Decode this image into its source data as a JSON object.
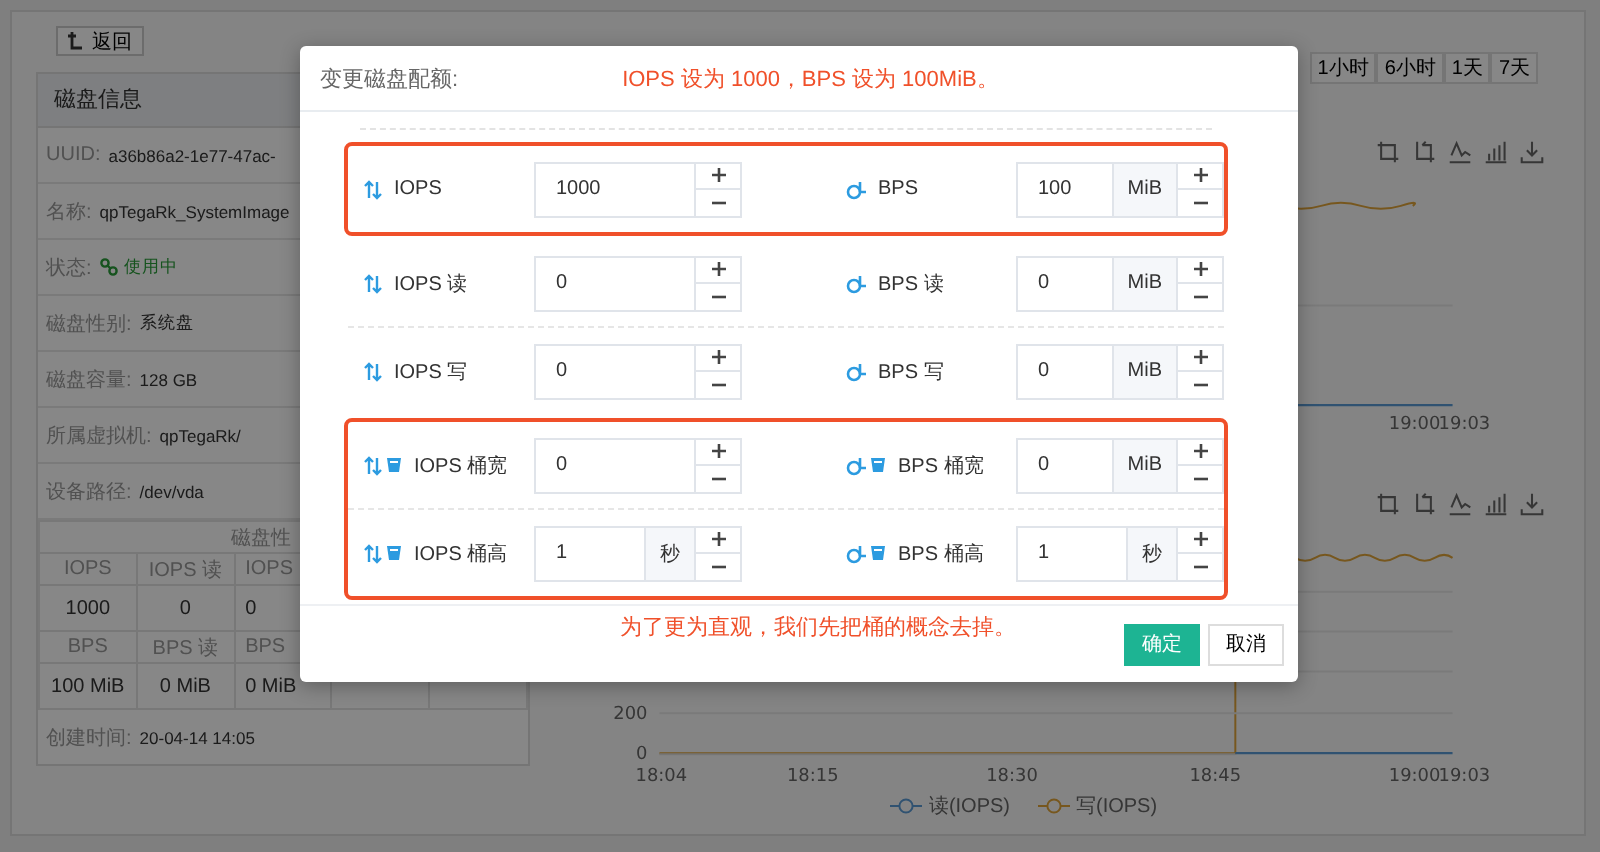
{
  "back_button": {
    "label": "返回"
  },
  "disk_info": {
    "title": "磁盘信息",
    "fields": [
      {
        "label": "UUID:",
        "value": "a36b86a2-1e77-47ac-",
        "kind": "text"
      },
      {
        "label": "名称:",
        "value": "qpTegaRk_SystemImage",
        "kind": "text"
      },
      {
        "label": "状态:",
        "value": "使用中",
        "kind": "status"
      },
      {
        "label": "磁盘性别:",
        "value": "系统盘",
        "kind": "text"
      },
      {
        "label": "磁盘容量:",
        "value": "128 GB",
        "kind": "text"
      },
      {
        "label": "所属虚拟机:",
        "value": "qpTegaRk/",
        "kind": "text"
      },
      {
        "label": "设备路径:",
        "value": "/dev/vda",
        "kind": "text"
      }
    ],
    "performance": {
      "title": "磁盘性",
      "rows": [
        {
          "kind": "header",
          "cells": [
            "IOPS",
            "IOPS 读",
            "IOPS"
          ]
        },
        {
          "kind": "value",
          "cells": [
            "1000",
            "0",
            "0"
          ]
        },
        {
          "kind": "header",
          "cells": [
            "BPS",
            "BPS 读",
            "BPS"
          ]
        },
        {
          "kind": "value",
          "cells": [
            "100 MiB",
            "0 MiB",
            "0 MiB"
          ]
        }
      ]
    },
    "created": {
      "label": "创建时间:",
      "value": "20-04-14 14:05"
    }
  },
  "time_ranges": [
    {
      "label": "1小时",
      "selected": false
    },
    {
      "label": "6小时",
      "selected": false
    },
    {
      "label": "1天",
      "selected": false
    },
    {
      "label": "7天",
      "selected": false
    }
  ],
  "charts": [
    {
      "x_labels": [
        "19:00",
        "19:03"
      ]
    },
    {
      "y_labels": [
        "200",
        "0"
      ],
      "x_labels": [
        "18:04",
        "18:15",
        "18:30",
        "18:45",
        "19:00",
        "19:03"
      ],
      "legend": [
        {
          "label": "读(IOPS)"
        },
        {
          "label": "写(IOPS)"
        }
      ]
    }
  ],
  "modal": {
    "title": "变更磁盘配额:",
    "top_note": "IOPS 设为 1000，BPS 设为 100MiB。",
    "groups": [
      {
        "highlighted": true,
        "rows": [
          [
            {
              "kind": "iops",
              "bucket": false,
              "label": "IOPS",
              "value": "1000"
            },
            {
              "kind": "bps",
              "bucket": false,
              "label": "BPS",
              "value": "100",
              "unit": "MiB"
            }
          ]
        ]
      },
      {
        "highlighted": false,
        "rows": [
          [
            {
              "kind": "iops",
              "bucket": false,
              "label": "IOPS 读",
              "value": "0"
            },
            {
              "kind": "bps",
              "bucket": false,
              "label": "BPS 读",
              "value": "0",
              "unit": "MiB"
            }
          ],
          [
            {
              "kind": "iops",
              "bucket": false,
              "label": "IOPS 写",
              "value": "0"
            },
            {
              "kind": "bps",
              "bucket": false,
              "label": "BPS 写",
              "value": "0",
              "unit": "MiB"
            }
          ]
        ]
      },
      {
        "highlighted": true,
        "rows": [
          [
            {
              "kind": "iops",
              "bucket": true,
              "label": "IOPS 桶宽",
              "value": "0"
            },
            {
              "kind": "bps",
              "bucket": true,
              "label": "BPS 桶宽",
              "value": "0",
              "unit": "MiB"
            }
          ],
          [
            {
              "kind": "iops",
              "bucket": true,
              "label": "IOPS 桶高",
              "value": "1",
              "unit": "秒"
            },
            {
              "kind": "bps",
              "bucket": true,
              "label": "BPS 桶高",
              "value": "1",
              "unit": "秒"
            }
          ]
        ]
      }
    ],
    "bottom_note": "为了更为直观，我们先把桶的概念去掉。",
    "buttons": [
      {
        "label": "确定",
        "kind": "primary"
      },
      {
        "label": "取消",
        "kind": "default"
      }
    ]
  }
}
